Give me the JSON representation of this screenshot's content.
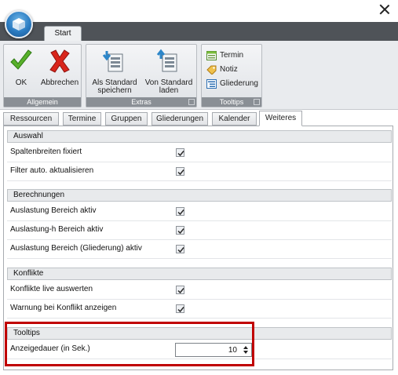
{
  "window": {
    "close_icon": "close-icon"
  },
  "ribbon": {
    "tab_label": "Start",
    "groups": {
      "allgemein": {
        "caption": "Allgemein",
        "ok_label": "OK",
        "abbrechen_label": "Abbrechen"
      },
      "extras": {
        "caption": "Extras",
        "als_standard_speichern_label": "Als Standard\nspeichern",
        "von_standard_laden_label": "Von Standard\nladen"
      },
      "tooltips": {
        "caption": "Tooltips",
        "termin_label": "Termin",
        "notiz_label": "Notiz",
        "gliederung_label": "Gliederung"
      }
    }
  },
  "tabs": [
    "Ressourcen",
    "Termine",
    "Gruppen",
    "Gliederungen",
    "Kalender",
    "Weiteres"
  ],
  "active_tab": "Weiteres",
  "sections": {
    "auswahl": {
      "title": "Auswahl",
      "rows": [
        {
          "label": "Spaltenbreiten fixiert",
          "checked": true
        },
        {
          "label": "Filter auto. aktualisieren",
          "checked": true
        }
      ]
    },
    "berechnungen": {
      "title": "Berechnungen",
      "rows": [
        {
          "label": "Auslastung Bereich aktiv",
          "checked": true
        },
        {
          "label": "Auslastung-h Bereich aktiv",
          "checked": true
        },
        {
          "label": "Auslastung Bereich (Gliederung) aktiv",
          "checked": true
        }
      ]
    },
    "konflikte": {
      "title": "Konflikte",
      "rows": [
        {
          "label": "Konflikte live auswerten",
          "checked": true
        },
        {
          "label": "Warnung bei Konflikt anzeigen",
          "checked": true
        }
      ]
    },
    "tooltips": {
      "title": "Tooltips",
      "rows": [
        {
          "label": "Anzeigedauer (in Sek.)",
          "value": "10"
        }
      ]
    }
  },
  "colors": {
    "highlight": "#c00000",
    "ribbon_dark": "#4f5358",
    "caption_gray": "#8a8f95"
  }
}
